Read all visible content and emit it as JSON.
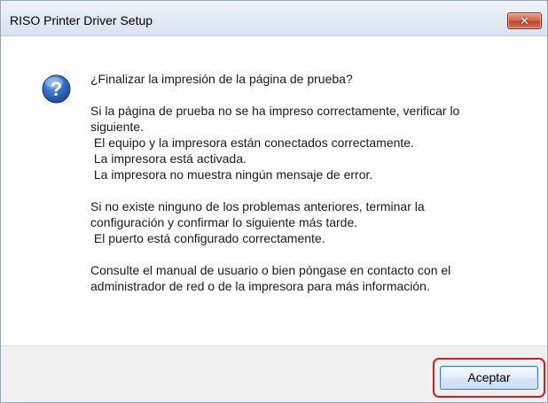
{
  "window": {
    "title": "RISO Printer Driver Setup",
    "close_label": "✕"
  },
  "dialog": {
    "question": "¿Finalizar la impresión de la página de prueba?",
    "paragraph1": [
      "Si la página de prueba no se ha impreso correctamente, verificar lo",
      "siguiente.",
      " El equipo y la impresora están conectados correctamente.",
      " La impresora está activada.",
      " La impresora no muestra ningún mensaje de error."
    ],
    "paragraph2": [
      "Si no existe ninguno de los problemas anteriores, terminar la",
      "configuración y confirmar lo siguiente más tarde.",
      " El puerto está configurado correctamente."
    ],
    "paragraph3": [
      "Consulte el manual de usuario o bien póngase en contacto con el",
      "administrador de red o de la impresora para más información."
    ],
    "icon": "question-icon"
  },
  "footer": {
    "ok_label": "Aceptar"
  },
  "colors": {
    "highlight": "#d21e1e",
    "question_icon": "#2a62b8"
  }
}
